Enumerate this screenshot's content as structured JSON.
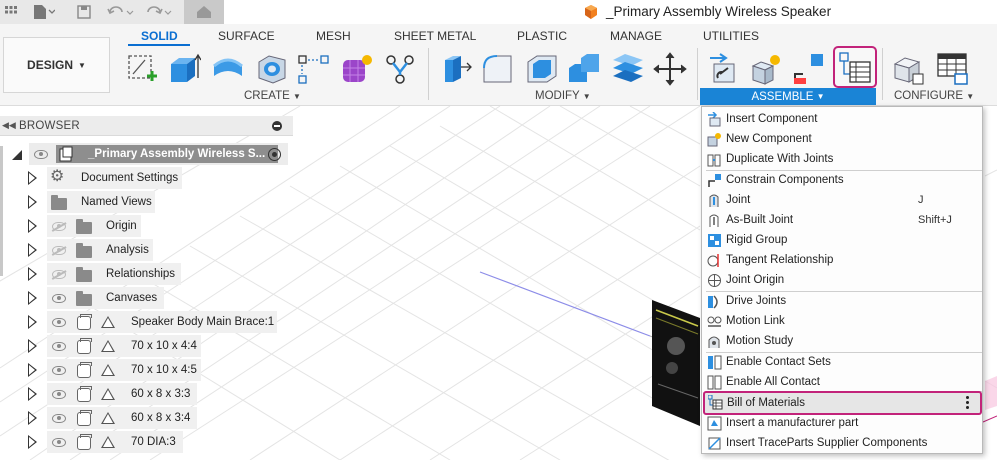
{
  "window": {
    "document_title": "_Primary Assembly Wireless Speaker"
  },
  "ribbon": {
    "workspace_button": "DESIGN",
    "tabs": [
      {
        "label": "SOLID",
        "active": true
      },
      {
        "label": "SURFACE"
      },
      {
        "label": "MESH"
      },
      {
        "label": "SHEET METAL"
      },
      {
        "label": "PLASTIC"
      },
      {
        "label": "MANAGE"
      },
      {
        "label": "UTILITIES"
      }
    ],
    "groups": {
      "create": "CREATE",
      "modify": "MODIFY",
      "assemble": "ASSEMBLE",
      "configure": "CONFIGURE"
    },
    "accent_color": "#0a6ed1",
    "highlight_color": "#c2237a"
  },
  "browser": {
    "title": "BROWSER",
    "root_label": "_Primary Assembly Wireless S...",
    "items": [
      {
        "label": "Document Settings",
        "icon": "gear-icon",
        "visible_eye": false
      },
      {
        "label": "Named Views",
        "icon": "folder-icon",
        "visible_eye": false
      },
      {
        "label": "Origin",
        "icon": "folder-icon",
        "eye": "hidden"
      },
      {
        "label": "Analysis",
        "icon": "folder-icon",
        "eye": "hidden"
      },
      {
        "label": "Relationships",
        "icon": "folder-icon",
        "eye": "hidden"
      },
      {
        "label": "Canvases",
        "icon": "folder-icon",
        "eye": "visible"
      },
      {
        "label": "Speaker Body Main Brace:1",
        "icon": "component-icon",
        "eye": "visible"
      },
      {
        "label": "70 x 10 x 4:4",
        "icon": "component-icon",
        "eye": "visible"
      },
      {
        "label": "70 x 10 x 4:5",
        "icon": "component-icon",
        "eye": "visible"
      },
      {
        "label": "60 x 8 x 3:3",
        "icon": "component-icon",
        "eye": "visible"
      },
      {
        "label": "60 x 8 x 3:4",
        "icon": "component-icon",
        "eye": "visible"
      },
      {
        "label": "70 DIA:3",
        "icon": "component-icon",
        "eye": "visible"
      }
    ]
  },
  "assemble_menu": {
    "items": [
      {
        "label": "Insert Component",
        "icon": "insert-component-icon"
      },
      {
        "label": "New Component",
        "icon": "new-component-icon"
      },
      {
        "label": "Duplicate With Joints",
        "icon": "duplicate-joints-icon"
      },
      {
        "label": "Constrain Components",
        "icon": "constrain-icon"
      },
      {
        "label": "Joint",
        "shortcut": "J",
        "icon": "joint-icon"
      },
      {
        "label": "As-Built Joint",
        "shortcut": "Shift+J",
        "icon": "as-built-joint-icon"
      },
      {
        "label": "Rigid Group",
        "icon": "rigid-group-icon"
      },
      {
        "label": "Tangent Relationship",
        "icon": "tangent-icon"
      },
      {
        "label": "Joint Origin",
        "icon": "joint-origin-icon"
      },
      {
        "label": "Drive Joints",
        "icon": "drive-joints-icon"
      },
      {
        "label": "Motion Link",
        "icon": "motion-link-icon"
      },
      {
        "label": "Motion Study",
        "icon": "motion-study-icon"
      },
      {
        "label": "Enable Contact Sets",
        "icon": "contact-sets-icon"
      },
      {
        "label": "Enable All Contact",
        "icon": "all-contact-icon"
      },
      {
        "label": "Bill of Materials",
        "icon": "bom-icon",
        "highlighted": true
      },
      {
        "label": "Insert a manufacturer part",
        "icon": "manufacturer-part-icon"
      },
      {
        "label": "Insert TraceParts Supplier Components",
        "icon": "traceparts-icon"
      }
    ]
  }
}
